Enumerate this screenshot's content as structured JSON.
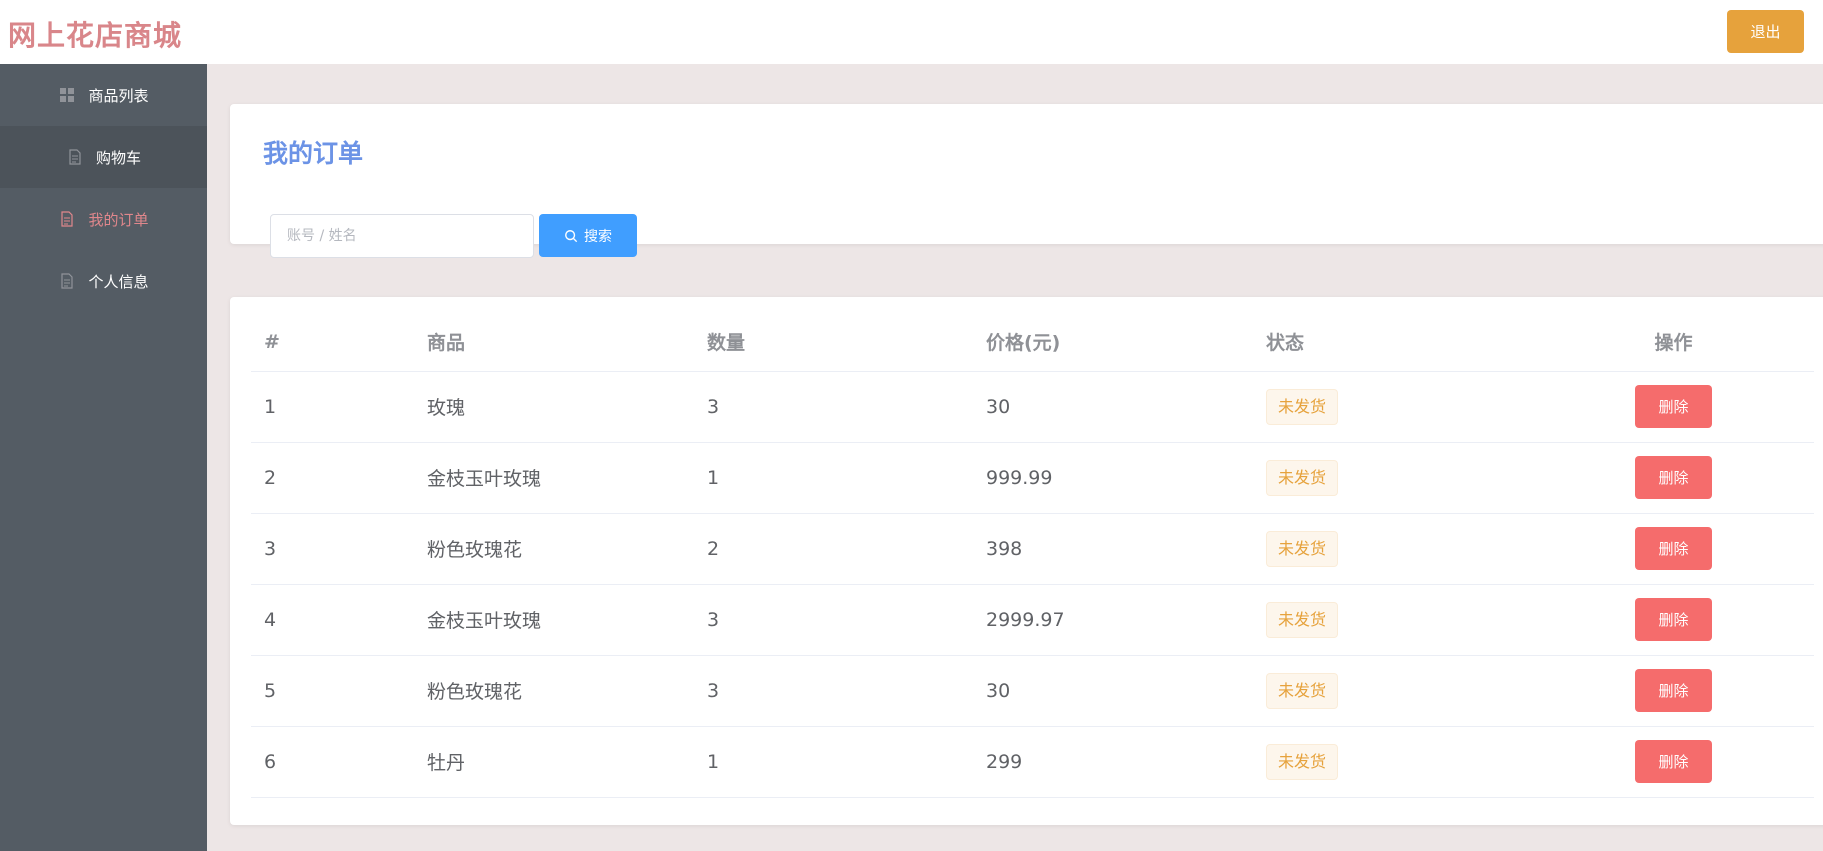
{
  "header": {
    "brand": "网上花店商城",
    "logout_label": "退出"
  },
  "sidebar": {
    "items": [
      {
        "label": "商品列表",
        "icon": "grid-icon"
      },
      {
        "label": "购物车",
        "icon": "document-icon"
      },
      {
        "label": "我的订单",
        "icon": "document-icon",
        "active": true
      },
      {
        "label": "个人信息",
        "icon": "document-icon"
      }
    ]
  },
  "main": {
    "title": "我的订单",
    "search": {
      "placeholder": "账号 / 姓名",
      "button_label": "搜索"
    },
    "table": {
      "columns": [
        "#",
        "商品",
        "数量",
        "价格(元)",
        "状态",
        "操作"
      ],
      "rows": [
        {
          "id": "1",
          "product": "玫瑰",
          "qty": "3",
          "price": "30",
          "status": "未发货",
          "action": "删除"
        },
        {
          "id": "2",
          "product": "金枝玉叶玫瑰",
          "qty": "1",
          "price": "999.99",
          "status": "未发货",
          "action": "删除"
        },
        {
          "id": "3",
          "product": "粉色玫瑰花",
          "qty": "2",
          "price": "398",
          "status": "未发货",
          "action": "删除"
        },
        {
          "id": "4",
          "product": "金枝玉叶玫瑰",
          "qty": "3",
          "price": "2999.97",
          "status": "未发货",
          "action": "删除"
        },
        {
          "id": "5",
          "product": "粉色玫瑰花",
          "qty": "3",
          "price": "30",
          "status": "未发货",
          "action": "删除"
        },
        {
          "id": "6",
          "product": "牡丹",
          "qty": "1",
          "price": "299",
          "status": "未发货",
          "action": "删除"
        }
      ]
    }
  },
  "colors": {
    "brand": "#d9868a",
    "sidebar_bg": "#545c64",
    "active": "#e0878c",
    "primary": "#409eff",
    "warning": "#e6a23c",
    "danger": "#f56c6c",
    "title": "#6c93e6"
  }
}
